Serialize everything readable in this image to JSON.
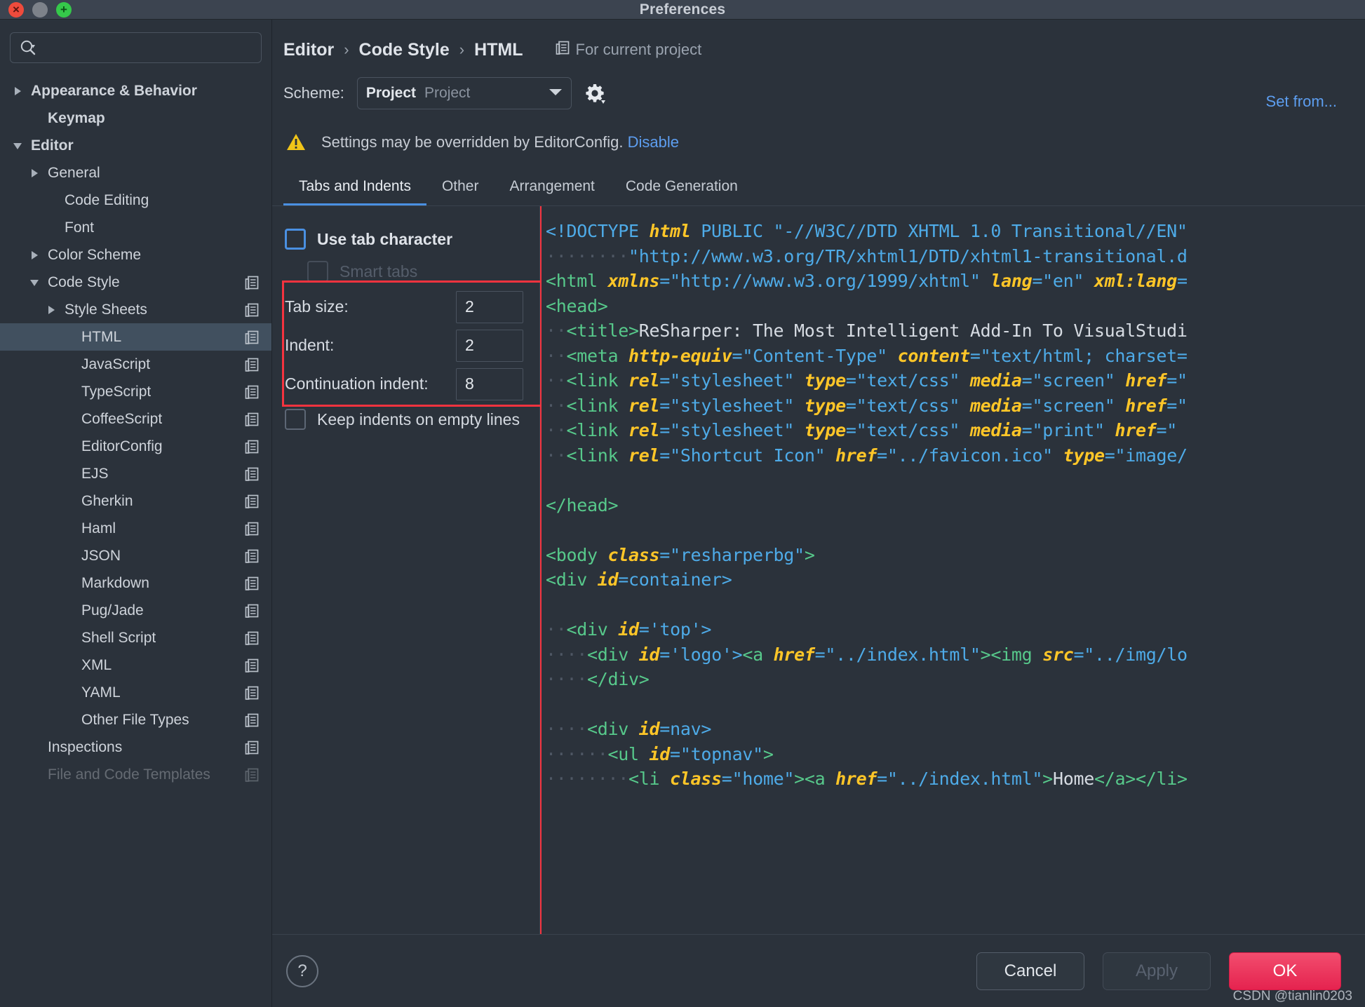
{
  "window": {
    "title": "Preferences",
    "controls": {
      "close": "×",
      "minimize": "",
      "zoom": "+"
    }
  },
  "sidebar": {
    "search": {
      "placeholder": "",
      "value": "",
      "icon": "search-icon"
    },
    "items": [
      {
        "label": "Appearance & Behavior",
        "indent": 0,
        "arrow": "right",
        "bold": true,
        "copy": false,
        "selected": false
      },
      {
        "label": "Keymap",
        "indent": 1,
        "arrow": "none",
        "bold": true,
        "copy": false,
        "selected": false
      },
      {
        "label": "Editor",
        "indent": 0,
        "arrow": "down",
        "bold": true,
        "copy": false,
        "selected": false
      },
      {
        "label": "General",
        "indent": 1,
        "arrow": "right",
        "bold": false,
        "copy": false,
        "selected": false
      },
      {
        "label": "Code Editing",
        "indent": 2,
        "arrow": "none",
        "bold": false,
        "copy": false,
        "selected": false
      },
      {
        "label": "Font",
        "indent": 2,
        "arrow": "none",
        "bold": false,
        "copy": false,
        "selected": false
      },
      {
        "label": "Color Scheme",
        "indent": 1,
        "arrow": "right",
        "bold": false,
        "copy": false,
        "selected": false
      },
      {
        "label": "Code Style",
        "indent": 1,
        "arrow": "down",
        "bold": false,
        "copy": true,
        "selected": false
      },
      {
        "label": "Style Sheets",
        "indent": 2,
        "arrow": "right",
        "bold": false,
        "copy": true,
        "selected": false
      },
      {
        "label": "HTML",
        "indent": 3,
        "arrow": "none",
        "bold": false,
        "copy": true,
        "selected": true
      },
      {
        "label": "JavaScript",
        "indent": 3,
        "arrow": "none",
        "bold": false,
        "copy": true,
        "selected": false
      },
      {
        "label": "TypeScript",
        "indent": 3,
        "arrow": "none",
        "bold": false,
        "copy": true,
        "selected": false
      },
      {
        "label": "CoffeeScript",
        "indent": 3,
        "arrow": "none",
        "bold": false,
        "copy": true,
        "selected": false
      },
      {
        "label": "EditorConfig",
        "indent": 3,
        "arrow": "none",
        "bold": false,
        "copy": true,
        "selected": false
      },
      {
        "label": "EJS",
        "indent": 3,
        "arrow": "none",
        "bold": false,
        "copy": true,
        "selected": false
      },
      {
        "label": "Gherkin",
        "indent": 3,
        "arrow": "none",
        "bold": false,
        "copy": true,
        "selected": false
      },
      {
        "label": "Haml",
        "indent": 3,
        "arrow": "none",
        "bold": false,
        "copy": true,
        "selected": false
      },
      {
        "label": "JSON",
        "indent": 3,
        "arrow": "none",
        "bold": false,
        "copy": true,
        "selected": false
      },
      {
        "label": "Markdown",
        "indent": 3,
        "arrow": "none",
        "bold": false,
        "copy": true,
        "selected": false
      },
      {
        "label": "Pug/Jade",
        "indent": 3,
        "arrow": "none",
        "bold": false,
        "copy": true,
        "selected": false
      },
      {
        "label": "Shell Script",
        "indent": 3,
        "arrow": "none",
        "bold": false,
        "copy": true,
        "selected": false
      },
      {
        "label": "XML",
        "indent": 3,
        "arrow": "none",
        "bold": false,
        "copy": true,
        "selected": false
      },
      {
        "label": "YAML",
        "indent": 3,
        "arrow": "none",
        "bold": false,
        "copy": true,
        "selected": false
      },
      {
        "label": "Other File Types",
        "indent": 3,
        "arrow": "none",
        "bold": false,
        "copy": true,
        "selected": false
      },
      {
        "label": "Inspections",
        "indent": 1,
        "arrow": "none",
        "bold": false,
        "copy": true,
        "selected": false
      },
      {
        "label": "File and Code Templates",
        "indent": 1,
        "arrow": "none",
        "bold": false,
        "copy": true,
        "selected": false,
        "clipped": true
      }
    ]
  },
  "header": {
    "breadcrumb": [
      "Editor",
      "Code Style",
      "HTML"
    ],
    "breadcrumb_separator": "›",
    "for_current_project": "For current project",
    "scheme_label": "Scheme:",
    "scheme_value": "Project",
    "scheme_sub": "Project",
    "set_from": "Set from...",
    "warning": {
      "text": "Settings may be overridden by EditorConfig.",
      "link": "Disable",
      "icon": "warning-triangle-icon"
    }
  },
  "tabs": [
    {
      "label": "Tabs and Indents",
      "active": true
    },
    {
      "label": "Other",
      "active": false
    },
    {
      "label": "Arrangement",
      "active": false
    },
    {
      "label": "Code Generation",
      "active": false
    }
  ],
  "settings": {
    "use_tab_character": {
      "label": "Use tab character",
      "checked": false,
      "focused": true
    },
    "smart_tabs": {
      "label": "Smart tabs",
      "checked": false,
      "disabled": true
    },
    "fields": [
      {
        "label": "Tab size:",
        "value": "2"
      },
      {
        "label": "Indent:",
        "value": "2"
      },
      {
        "label": "Continuation indent:",
        "value": "8"
      }
    ],
    "keep_indents": {
      "label": "Keep indents on empty lines",
      "checked": false
    },
    "highlight_color": "#f5333f"
  },
  "preview": {
    "lines": [
      [
        {
          "t": "<!DOCTYPE ",
          "c": "pn"
        },
        {
          "t": "html",
          "c": "at"
        },
        {
          "t": " PUBLIC ",
          "c": "pn"
        },
        {
          "t": "\"-//W3C//DTD XHTML 1.0 Transitional//EN\"",
          "c": "st"
        }
      ],
      [
        {
          "t": "········",
          "c": "ws"
        },
        {
          "t": "\"http://www.w3.org/TR/xhtml1/DTD/xhtml1-transitional.d",
          "c": "st"
        }
      ],
      [
        {
          "t": "<html ",
          "c": "tg"
        },
        {
          "t": "xmlns",
          "c": "at"
        },
        {
          "t": "=",
          "c": "pn"
        },
        {
          "t": "\"http://www.w3.org/1999/xhtml\"",
          "c": "st"
        },
        {
          "t": " ",
          "c": "tx"
        },
        {
          "t": "lang",
          "c": "at"
        },
        {
          "t": "=",
          "c": "pn"
        },
        {
          "t": "\"en\"",
          "c": "st"
        },
        {
          "t": " ",
          "c": "tx"
        },
        {
          "t": "xml:lang",
          "c": "at"
        },
        {
          "t": "=",
          "c": "pn"
        }
      ],
      [
        {
          "t": "<head>",
          "c": "tg"
        }
      ],
      [
        {
          "t": "··",
          "c": "ws"
        },
        {
          "t": "<title>",
          "c": "tg"
        },
        {
          "t": "ReSharper: The Most Intelligent Add-In To VisualStudi",
          "c": "tx"
        }
      ],
      [
        {
          "t": "··",
          "c": "ws"
        },
        {
          "t": "<meta ",
          "c": "tg"
        },
        {
          "t": "http-equiv",
          "c": "at"
        },
        {
          "t": "=",
          "c": "pn"
        },
        {
          "t": "\"Content-Type\"",
          "c": "st"
        },
        {
          "t": " ",
          "c": "tx"
        },
        {
          "t": "content",
          "c": "at"
        },
        {
          "t": "=",
          "c": "pn"
        },
        {
          "t": "\"text/html; charset=",
          "c": "st"
        }
      ],
      [
        {
          "t": "··",
          "c": "ws"
        },
        {
          "t": "<link ",
          "c": "tg"
        },
        {
          "t": "rel",
          "c": "at"
        },
        {
          "t": "=",
          "c": "pn"
        },
        {
          "t": "\"stylesheet\"",
          "c": "st"
        },
        {
          "t": " ",
          "c": "tx"
        },
        {
          "t": "type",
          "c": "at"
        },
        {
          "t": "=",
          "c": "pn"
        },
        {
          "t": "\"text/css\"",
          "c": "st"
        },
        {
          "t": " ",
          "c": "tx"
        },
        {
          "t": "media",
          "c": "at"
        },
        {
          "t": "=",
          "c": "pn"
        },
        {
          "t": "\"screen\"",
          "c": "st"
        },
        {
          "t": " ",
          "c": "tx"
        },
        {
          "t": "href",
          "c": "at"
        },
        {
          "t": "=\"",
          "c": "pn"
        }
      ],
      [
        {
          "t": "··",
          "c": "ws"
        },
        {
          "t": "<link ",
          "c": "tg"
        },
        {
          "t": "rel",
          "c": "at"
        },
        {
          "t": "=",
          "c": "pn"
        },
        {
          "t": "\"stylesheet\"",
          "c": "st"
        },
        {
          "t": " ",
          "c": "tx"
        },
        {
          "t": "type",
          "c": "at"
        },
        {
          "t": "=",
          "c": "pn"
        },
        {
          "t": "\"text/css\"",
          "c": "st"
        },
        {
          "t": " ",
          "c": "tx"
        },
        {
          "t": "media",
          "c": "at"
        },
        {
          "t": "=",
          "c": "pn"
        },
        {
          "t": "\"screen\"",
          "c": "st"
        },
        {
          "t": " ",
          "c": "tx"
        },
        {
          "t": "href",
          "c": "at"
        },
        {
          "t": "=\"",
          "c": "pn"
        }
      ],
      [
        {
          "t": "··",
          "c": "ws"
        },
        {
          "t": "<link ",
          "c": "tg"
        },
        {
          "t": "rel",
          "c": "at"
        },
        {
          "t": "=",
          "c": "pn"
        },
        {
          "t": "\"stylesheet\"",
          "c": "st"
        },
        {
          "t": " ",
          "c": "tx"
        },
        {
          "t": "type",
          "c": "at"
        },
        {
          "t": "=",
          "c": "pn"
        },
        {
          "t": "\"text/css\"",
          "c": "st"
        },
        {
          "t": " ",
          "c": "tx"
        },
        {
          "t": "media",
          "c": "at"
        },
        {
          "t": "=",
          "c": "pn"
        },
        {
          "t": "\"print\"",
          "c": "st"
        },
        {
          "t": " ",
          "c": "tx"
        },
        {
          "t": "href",
          "c": "at"
        },
        {
          "t": "=\"",
          "c": "pn"
        }
      ],
      [
        {
          "t": "··",
          "c": "ws"
        },
        {
          "t": "<link ",
          "c": "tg"
        },
        {
          "t": "rel",
          "c": "at"
        },
        {
          "t": "=",
          "c": "pn"
        },
        {
          "t": "\"Shortcut Icon\"",
          "c": "st"
        },
        {
          "t": " ",
          "c": "tx"
        },
        {
          "t": "href",
          "c": "at"
        },
        {
          "t": "=",
          "c": "pn"
        },
        {
          "t": "\"../favicon.ico\"",
          "c": "st"
        },
        {
          "t": " ",
          "c": "tx"
        },
        {
          "t": "type",
          "c": "at"
        },
        {
          "t": "=",
          "c": "pn"
        },
        {
          "t": "\"image/",
          "c": "st"
        }
      ],
      [
        {
          "t": "",
          "c": "tx"
        }
      ],
      [
        {
          "t": "</head>",
          "c": "tg"
        }
      ],
      [
        {
          "t": "",
          "c": "tx"
        }
      ],
      [
        {
          "t": "<body ",
          "c": "tg"
        },
        {
          "t": "class",
          "c": "at"
        },
        {
          "t": "=",
          "c": "pn"
        },
        {
          "t": "\"resharperbg\"",
          "c": "st"
        },
        {
          "t": ">",
          "c": "tg"
        }
      ],
      [
        {
          "t": "<div ",
          "c": "tg"
        },
        {
          "t": "id",
          "c": "at"
        },
        {
          "t": "=",
          "c": "pn"
        },
        {
          "t": "container>",
          "c": "st"
        }
      ],
      [
        {
          "t": "",
          "c": "tx"
        }
      ],
      [
        {
          "t": "··",
          "c": "ws"
        },
        {
          "t": "<div ",
          "c": "tg"
        },
        {
          "t": "id",
          "c": "at"
        },
        {
          "t": "=",
          "c": "pn"
        },
        {
          "t": "'top'>",
          "c": "st"
        }
      ],
      [
        {
          "t": "····",
          "c": "ws"
        },
        {
          "t": "<div ",
          "c": "tg"
        },
        {
          "t": "id",
          "c": "at"
        },
        {
          "t": "=",
          "c": "pn"
        },
        {
          "t": "'logo'>",
          "c": "st"
        },
        {
          "t": "<a ",
          "c": "tg"
        },
        {
          "t": "href",
          "c": "at"
        },
        {
          "t": "=",
          "c": "pn"
        },
        {
          "t": "\"../index.html\"",
          "c": "st"
        },
        {
          "t": ">",
          "c": "tg"
        },
        {
          "t": "<img ",
          "c": "tg"
        },
        {
          "t": "src",
          "c": "at"
        },
        {
          "t": "=",
          "c": "pn"
        },
        {
          "t": "\"../img/lo",
          "c": "st"
        }
      ],
      [
        {
          "t": "····",
          "c": "ws"
        },
        {
          "t": "</div>",
          "c": "tg"
        }
      ],
      [
        {
          "t": "",
          "c": "tx"
        }
      ],
      [
        {
          "t": "····",
          "c": "ws"
        },
        {
          "t": "<div ",
          "c": "tg"
        },
        {
          "t": "id",
          "c": "at"
        },
        {
          "t": "=",
          "c": "pn"
        },
        {
          "t": "nav>",
          "c": "st"
        }
      ],
      [
        {
          "t": "······",
          "c": "ws"
        },
        {
          "t": "<ul ",
          "c": "tg"
        },
        {
          "t": "id",
          "c": "at"
        },
        {
          "t": "=",
          "c": "pn"
        },
        {
          "t": "\"topnav\"",
          "c": "st"
        },
        {
          "t": ">",
          "c": "tg"
        }
      ],
      [
        {
          "t": "········",
          "c": "ws"
        },
        {
          "t": "<li ",
          "c": "tg"
        },
        {
          "t": "class",
          "c": "at"
        },
        {
          "t": "=",
          "c": "pn"
        },
        {
          "t": "\"home\"",
          "c": "st"
        },
        {
          "t": ">",
          "c": "tg"
        },
        {
          "t": "<a ",
          "c": "tg"
        },
        {
          "t": "href",
          "c": "at"
        },
        {
          "t": "=",
          "c": "pn"
        },
        {
          "t": "\"../index.html\"",
          "c": "st"
        },
        {
          "t": ">",
          "c": "tg"
        },
        {
          "t": "Home",
          "c": "tx"
        },
        {
          "t": "</a></li>",
          "c": "tg"
        }
      ]
    ]
  },
  "footer": {
    "help": "?",
    "cancel": "Cancel",
    "apply": "Apply",
    "ok": "OK",
    "watermark": "CSDN @tianlin0203"
  }
}
